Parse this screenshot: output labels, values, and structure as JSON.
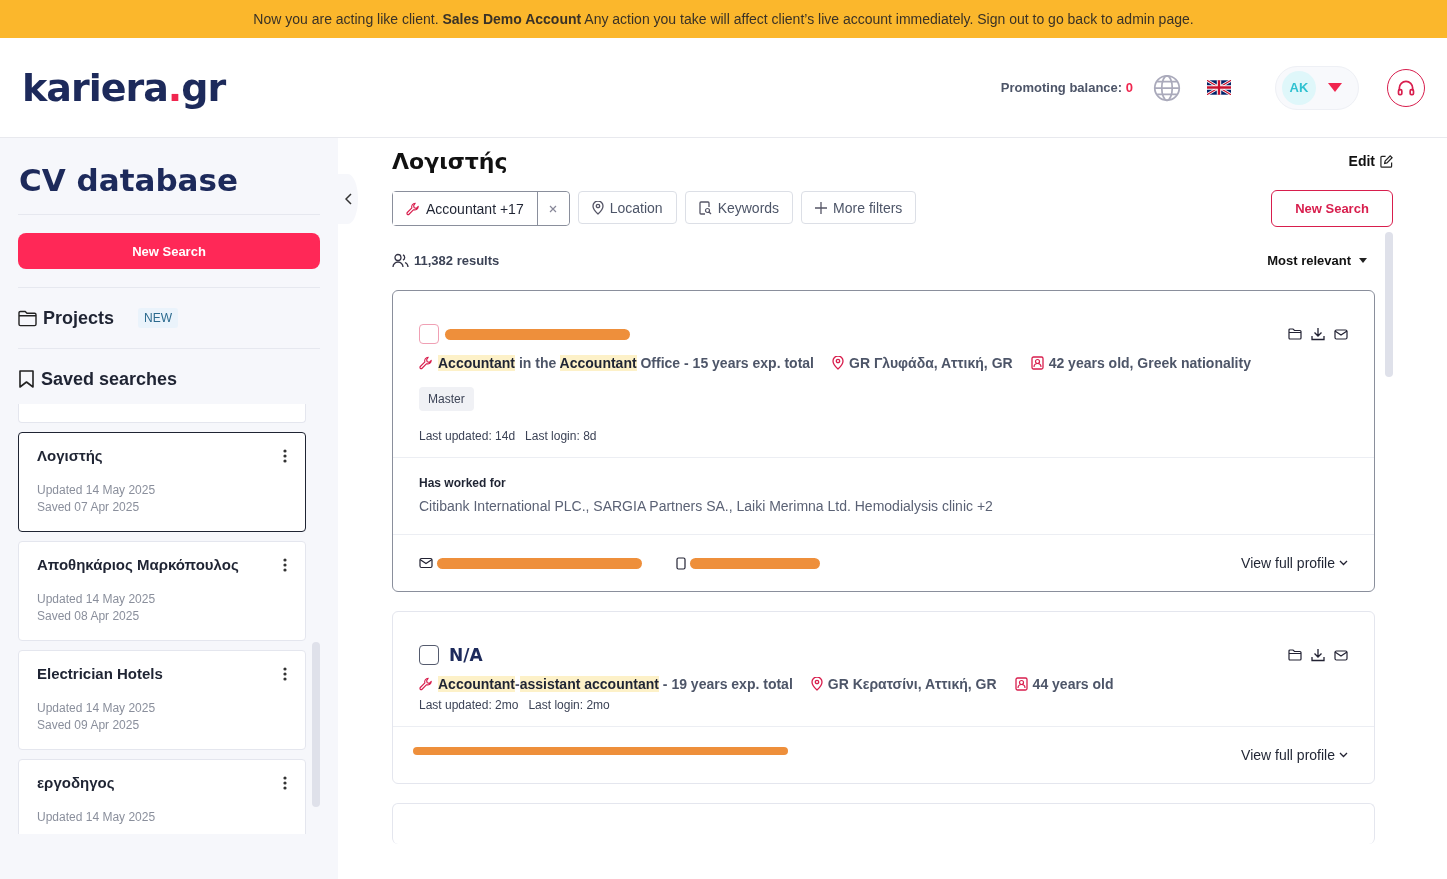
{
  "banner": {
    "text": "Now you are acting like client. **Sales Demo Account** Any action you take will affect client’s live account immediately. Sign out to go back to admin page."
  },
  "header": {
    "logo": {
      "name": "kariera",
      "dot": ".",
      "tld": "gr"
    },
    "balance_label": "Promoting balance:",
    "balance_value": "0",
    "user_initials": "AK"
  },
  "sidebar": {
    "title": "CV database",
    "new_search": "New Search",
    "projects": {
      "label": "Projects",
      "badge": "NEW"
    },
    "saved_searches_label": "Saved searches",
    "saved_searches": [
      {
        "name": "Λογιστής",
        "updated": "Updated 14 May 2025",
        "saved": "Saved 07 Apr 2025",
        "selected": true
      },
      {
        "name": "Αποθηκάριος Μαρκόπουλος",
        "updated": "Updated 14 May 2025",
        "saved": "Saved 08 Apr 2025",
        "selected": false
      },
      {
        "name": "Electrician Hotels",
        "updated": "Updated 14 May 2025",
        "saved": "Saved 09 Apr 2025",
        "selected": false
      },
      {
        "name": "εργοδηγος",
        "updated": "Updated 14 May 2025",
        "selected": false
      }
    ]
  },
  "main": {
    "title": "Λογιστής",
    "edit": "Edit",
    "filters": [
      {
        "kind": "keyword",
        "label": "Accountant +17"
      },
      {
        "kind": "location",
        "label": "Location"
      },
      {
        "kind": "keywords",
        "label": "Keywords"
      },
      {
        "kind": "more",
        "label": "More filters"
      }
    ],
    "new_search": "New Search",
    "results": "11,382 results",
    "sort": "Most relevant",
    "candidates": [
      {
        "hovered": true,
        "name_redacted": true,
        "role": [
          {
            "text": "Accountant",
            "highlight": true
          },
          {
            "text": " in the ",
            "highlight": false
          },
          {
            "text": "Accountant",
            "highlight": true
          },
          {
            "text": " Office - 15 years exp. total",
            "highlight": false
          }
        ],
        "location": "GR Γλυφάδα, Αττική, GR",
        "age": "42 years old, Greek nationality",
        "tags": [
          "Master"
        ],
        "last_updated": "Last updated: 14d",
        "last_login": "Last login: 8d",
        "worked_for": {
          "label": "Has worked for",
          "text": "Citibank International PLC., SARGIA Partners SA., Laiki Merimna Ltd. Hemodialysis clinic +2"
        },
        "contact_icons_visible": true,
        "view_profile": "View full profile"
      },
      {
        "hovered": false,
        "name": "N/A",
        "role": [
          {
            "text": "Accountant",
            "highlight": true
          },
          {
            "text": "-",
            "highlight": false
          },
          {
            "text": "assistant accountant",
            "highlight": true
          },
          {
            "text": " - 19 years exp. total",
            "highlight": false
          }
        ],
        "location": "GR Κερατσίνι, Αττική, GR",
        "age": "44 years old",
        "last_updated": "Last updated: 2mo",
        "last_login": "Last login: 2mo",
        "contact_icons_visible": false,
        "view_profile": "View full profile"
      }
    ]
  }
}
